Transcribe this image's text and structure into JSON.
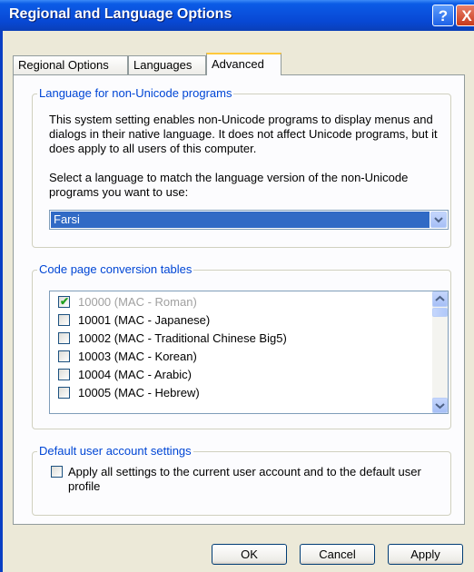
{
  "window": {
    "title": "Regional and Language Options",
    "help_symbol": "?",
    "close_symbol": "X"
  },
  "tabs": [
    {
      "label": "Regional Options",
      "active": false
    },
    {
      "label": "Languages",
      "active": false
    },
    {
      "label": "Advanced",
      "active": true
    }
  ],
  "non_unicode": {
    "group_title": "Language for non-Unicode programs",
    "description": "This system setting enables non-Unicode programs to display menus and dialogs in their native language. It does not affect Unicode programs, but it does apply to all users of this computer.",
    "prompt": "Select a language to match the language version of the non-Unicode programs you want to use:",
    "selected_language": "Farsi"
  },
  "code_pages": {
    "group_title": "Code page conversion tables",
    "items": [
      {
        "label": "10000 (MAC - Roman)",
        "checked": true,
        "disabled": true
      },
      {
        "label": "10001 (MAC - Japanese)",
        "checked": false,
        "disabled": false
      },
      {
        "label": "10002 (MAC - Traditional Chinese Big5)",
        "checked": false,
        "disabled": false
      },
      {
        "label": "10003 (MAC - Korean)",
        "checked": false,
        "disabled": false
      },
      {
        "label": "10004 (MAC - Arabic)",
        "checked": false,
        "disabled": false
      },
      {
        "label": "10005 (MAC - Hebrew)",
        "checked": false,
        "disabled": false
      }
    ]
  },
  "default_user": {
    "group_title": "Default user account settings",
    "checkbox_label": "Apply all settings to the current user account and to the default user profile",
    "checked": false
  },
  "buttons": {
    "ok": "OK",
    "cancel": "Cancel",
    "apply": "Apply"
  }
}
